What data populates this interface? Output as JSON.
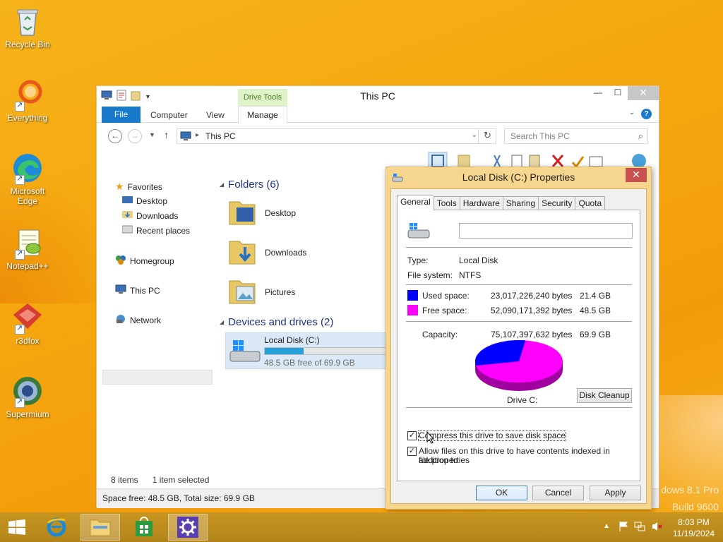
{
  "desktop": {
    "icons": [
      {
        "label": "Recycle Bin",
        "icon": "recycle-bin-icon"
      },
      {
        "label": "Everything",
        "icon": "everything-icon"
      },
      {
        "label": "Microsoft Edge",
        "icon": "edge-icon"
      },
      {
        "label": "Notepad++",
        "icon": "notepad-plus-plus-icon"
      },
      {
        "label": "r3dfox",
        "icon": "r3dfox-icon"
      },
      {
        "label": "Supermium",
        "icon": "supermium-icon"
      }
    ],
    "watermark_line1": "dows 8.1 Pro",
    "watermark_line2": "Build 9600"
  },
  "explorer": {
    "title": "This PC",
    "context_tab": "Drive Tools",
    "tabs": {
      "file": "File",
      "computer": "Computer",
      "view": "View",
      "manage": "Manage"
    },
    "address": {
      "path": "This PC",
      "separator": "▸"
    },
    "search_placeholder": "Search This PC",
    "nav": {
      "favorites": "Favorites",
      "desktop": "Desktop",
      "downloads": "Downloads",
      "recent": "Recent places",
      "homegroup": "Homegroup",
      "this_pc": "This PC",
      "network": "Network"
    },
    "folders_header": "Folders (6)",
    "folders": [
      {
        "name": "Desktop"
      },
      {
        "name": "Downloads"
      },
      {
        "name": "Pictures"
      }
    ],
    "devices_header": "Devices and drives (2)",
    "drive": {
      "name": "Local Disk (C:)",
      "free_text": "48.5 GB free of 69.9 GB",
      "used_fraction": 0.306
    },
    "status_items": "8 items",
    "status_selected": "1 item selected",
    "status_bar": "Space free: 48.5 GB, Total size: 69.9 GB"
  },
  "properties": {
    "title": "Local Disk (C:) Properties",
    "tabs": [
      "General",
      "Tools",
      "Hardware",
      "Sharing",
      "Security",
      "Quota"
    ],
    "label_value": "",
    "type_label": "Type:",
    "type_value": "Local Disk",
    "fs_label": "File system:",
    "fs_value": "NTFS",
    "used_label": "Used space:",
    "used_bytes": "23,017,226,240 bytes",
    "used_gb": "21.4 GB",
    "free_label": "Free space:",
    "free_bytes": "52,090,171,392 bytes",
    "free_gb": "48.5 GB",
    "capacity_label": "Capacity:",
    "capacity_bytes": "75,107,397,632 bytes",
    "capacity_gb": "69.9 GB",
    "drive_caption": "Drive C:",
    "disk_cleanup": "Disk Cleanup",
    "compress_label": "Compress this drive to save disk space",
    "compress_checked": true,
    "index_label_1": "Allow files on this drive to have contents indexed in addition to",
    "index_label_2": "file properties",
    "index_checked": true,
    "ok": "OK",
    "cancel": "Cancel",
    "apply": "Apply",
    "colors": {
      "used": "#0000ff",
      "free": "#ff00ff"
    }
  },
  "taskbar": {
    "time": "8:03 PM",
    "date": "11/19/2024"
  }
}
